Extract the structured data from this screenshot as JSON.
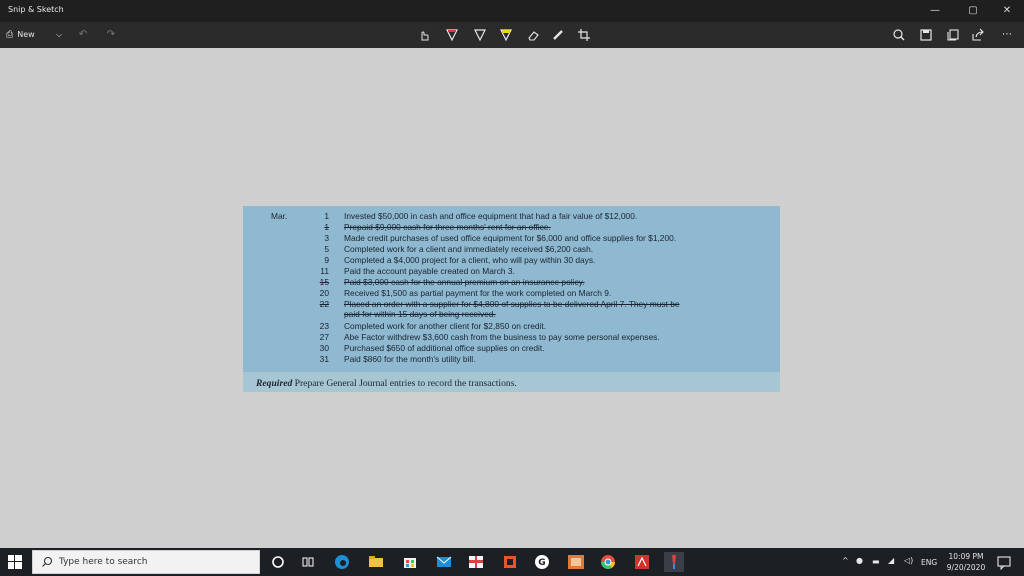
{
  "window": {
    "title": "Snip & Sketch",
    "controls": [
      "minimize",
      "maximize",
      "close"
    ]
  },
  "toolbar": {
    "new_label": "New",
    "left_icons": [
      "new-snip-icon",
      "chevron-down-icon",
      "undo-icon",
      "redo-icon"
    ],
    "tools": [
      "touch-writing-icon",
      "ballpoint-pen-icon",
      "pencil-icon",
      "highlighter-icon",
      "eraser-icon",
      "ruler-icon",
      "crop-icon"
    ],
    "right_icons": [
      "zoom-icon",
      "save-icon",
      "copy-icon",
      "share-icon",
      "more-icon"
    ],
    "active_tool_color": "#3a8ee6"
  },
  "snip": {
    "month": "Mar.",
    "entries": [
      {
        "day": "1",
        "text": "Invested $50,000 in cash and office equipment that had a fair value of $12,000.",
        "struck": false
      },
      {
        "day": "1",
        "text": "Prepaid $9,000 cash for three months' rent for an office.",
        "struck": true
      },
      {
        "day": "3",
        "text": "Made credit purchases of used office equipment for $6,000 and office supplies for $1,200.",
        "struck": false
      },
      {
        "day": "5",
        "text": "Completed work for a client and immediately received $6,200 cash.",
        "struck": false
      },
      {
        "day": "9",
        "text": "Completed a $4,000 project for a client, who will pay within 30 days.",
        "struck": false
      },
      {
        "day": "11",
        "text": "Paid the account payable created on March 3.",
        "struck": false
      },
      {
        "day": "15",
        "text": "Paid $3,000 cash for the annual premium on an insurance policy.",
        "struck": true
      },
      {
        "day": "20",
        "text": "Received $1,500 as partial payment for the work completed on March 9.",
        "struck": false
      },
      {
        "day": "22",
        "text": "Placed an order with a supplier for $4,800 of supplies to be delivered April 7. They must be",
        "struck": true
      },
      {
        "day": "",
        "text": "paid for within 15 days of being received.",
        "struck": true
      },
      {
        "day": "23",
        "text": "Completed work for another client for $2,850 on credit.",
        "struck": false
      },
      {
        "day": "27",
        "text": "Abe Factor withdrew $3,600 cash from the business to pay some personal expenses.",
        "struck": false
      },
      {
        "day": "30",
        "text": "Purchased $650 of additional office supplies on credit.",
        "struck": false
      },
      {
        "day": "31",
        "text": "Paid $860 for the month's utility bill.",
        "struck": false
      }
    ],
    "required_label": "Required",
    "required_text": "Prepare General Journal entries to record the transactions."
  },
  "taskbar": {
    "search_placeholder": "Type here to search",
    "apps": [
      "cortana-icon",
      "task-view-icon",
      "edge-icon",
      "file-explorer-icon",
      "store-icon",
      "mail-icon",
      "gift-icon",
      "office-icon",
      "g-app-icon",
      "photos-icon",
      "chrome-icon",
      "acrobat-icon",
      "snip-sketch-icon"
    ],
    "lang": "ENG",
    "time": "10:09 PM",
    "date": "9/20/2020"
  }
}
